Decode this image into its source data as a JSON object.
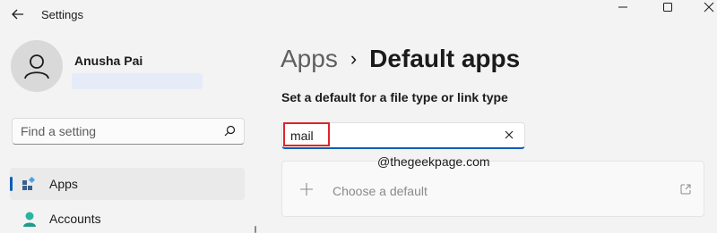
{
  "window": {
    "title": "Settings"
  },
  "user": {
    "name": "Anusha Pai"
  },
  "sidebar": {
    "search_placeholder": "Find a setting",
    "items": [
      {
        "label": "Apps",
        "selected": true
      },
      {
        "label": "Accounts",
        "selected": false
      }
    ]
  },
  "main": {
    "breadcrumb": {
      "parent": "Apps",
      "separator": "›",
      "current": "Default apps"
    },
    "section_label": "Set a default for a file type or link type",
    "type_search_value": "mail",
    "watermark": "@thegeekpage.com",
    "choose_default_label": "Choose a default"
  },
  "colors": {
    "accent": "#005fb8",
    "highlight": "#e0242a",
    "background": "#f3f3f3"
  }
}
